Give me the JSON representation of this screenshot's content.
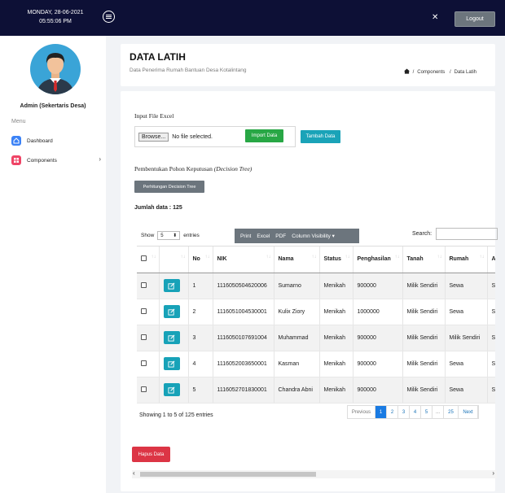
{
  "topbar": {
    "date": "MONDAY, 28-06-2021",
    "time": "05:55:06 PM",
    "logout_label": "Logout"
  },
  "sidebar": {
    "user_name": "Admin (Sekertaris Desa)",
    "menu_title": "Menu",
    "items": [
      {
        "label": "Dashboard",
        "icon": "home-icon",
        "color": "#3b82f6"
      },
      {
        "label": "Components",
        "icon": "grid-icon",
        "color": "#ef4466"
      }
    ]
  },
  "header": {
    "title": "DATA LATIH",
    "subtitle": "Data Penerima Rumah Bantuan Desa Kotalintang",
    "breadcrumb": [
      "Components",
      "Data Latih"
    ]
  },
  "upload": {
    "label": "Input File Excel",
    "browse_label": "Browse...",
    "file_status": "No file selected.",
    "import_label": "Import Data",
    "add_label": "Tambah Data"
  },
  "tree": {
    "label_prefix": "Pembentukan Pohon Keputusan ",
    "label_italic": "(Decision Tree)",
    "button_label": "Perhitungan Decision Tree"
  },
  "jumlah_label": "Jumlah data : 125",
  "table_controls": {
    "show_label": "Show",
    "show_value": "5",
    "entries_label": "entries",
    "buttons": [
      "Print",
      "Excel",
      "PDF",
      "Column Visibility ▾"
    ],
    "search_label": "Search:"
  },
  "table": {
    "columns": [
      "",
      "",
      "No",
      "NIK",
      "Nama",
      "Status",
      "Penghasilan",
      "Tanah",
      "Rumah",
      "A"
    ],
    "rows": [
      {
        "no": "1",
        "nik": "1116050504620006",
        "nama": "Sumarno",
        "status": "Menikah",
        "penghasilan": "900000",
        "tanah": "Milik Sendiri",
        "rumah": "Sewa",
        "extra": "S"
      },
      {
        "no": "2",
        "nik": "1116051004530001",
        "nama": "Kulix Ziory",
        "status": "Menikah",
        "penghasilan": "1000000",
        "tanah": "Milik Sendiri",
        "rumah": "Sewa",
        "extra": "S"
      },
      {
        "no": "3",
        "nik": "1116050107691004",
        "nama": "Muhammad",
        "status": "Menikah",
        "penghasilan": "900000",
        "tanah": "Milik Sendiri",
        "rumah": "Milik Sendiri",
        "extra": "S"
      },
      {
        "no": "4",
        "nik": "1116052003650001",
        "nama": "Kasman",
        "status": "Menikah",
        "penghasilan": "900000",
        "tanah": "Milik Sendiri",
        "rumah": "Sewa",
        "extra": "S"
      },
      {
        "no": "5",
        "nik": "1116052701830001",
        "nama": "Chandra Abni",
        "status": "Menikah",
        "penghasilan": "900000",
        "tanah": "Milik Sendiri",
        "rumah": "Sewa",
        "extra": "S"
      }
    ]
  },
  "info_text": "Showing 1 to 5 of 125 entries",
  "pagination": [
    "Previous",
    "1",
    "2",
    "3",
    "4",
    "5",
    "...",
    "25",
    "Next"
  ],
  "delete_label": "Hapus Data"
}
